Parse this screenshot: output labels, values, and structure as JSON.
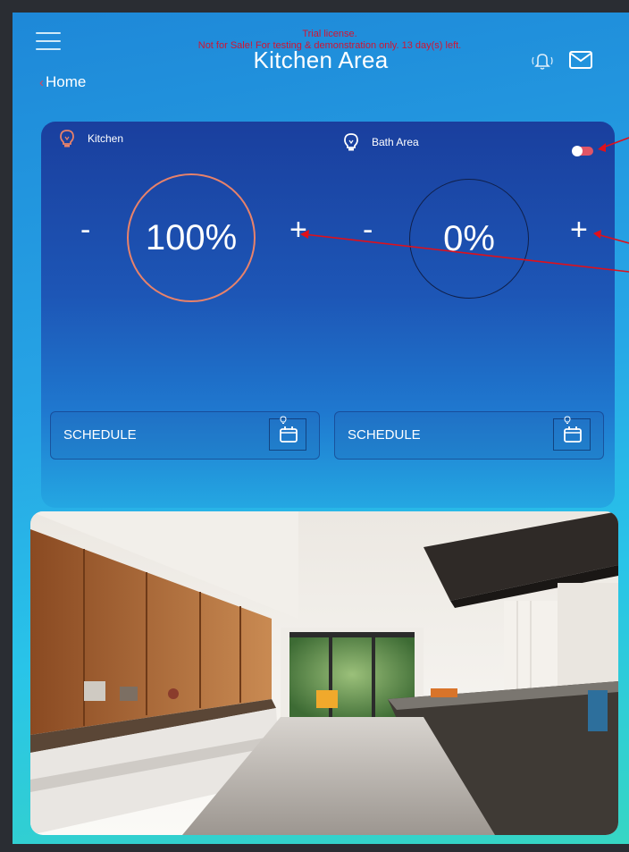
{
  "header": {
    "title": "Kitchen Area",
    "watermark_line1": "Trial license.",
    "watermark_line2": "Not for Sale! For testing & demonstration only. 13 day(s) left.",
    "back_label": "Home",
    "icons": [
      "menu-icon",
      "bell-icon",
      "mail-icon"
    ]
  },
  "zones": [
    {
      "name": "Kitchen",
      "level": "100%",
      "schedule_label": "SCHEDULE",
      "ring_color": "#e8826a",
      "bulb_color": "#e8826a"
    },
    {
      "name": "Bath Area",
      "level": "0%",
      "schedule_label": "SCHEDULE",
      "ring_color": "#10204a",
      "bulb_color": "#ffffff"
    }
  ],
  "controls": {
    "minus": "-",
    "plus": "+"
  },
  "toggle": {
    "state": "on",
    "color": "#e05566"
  },
  "annotation_color": "#e0101a",
  "image": {
    "subject": "modern kitchen photo"
  }
}
